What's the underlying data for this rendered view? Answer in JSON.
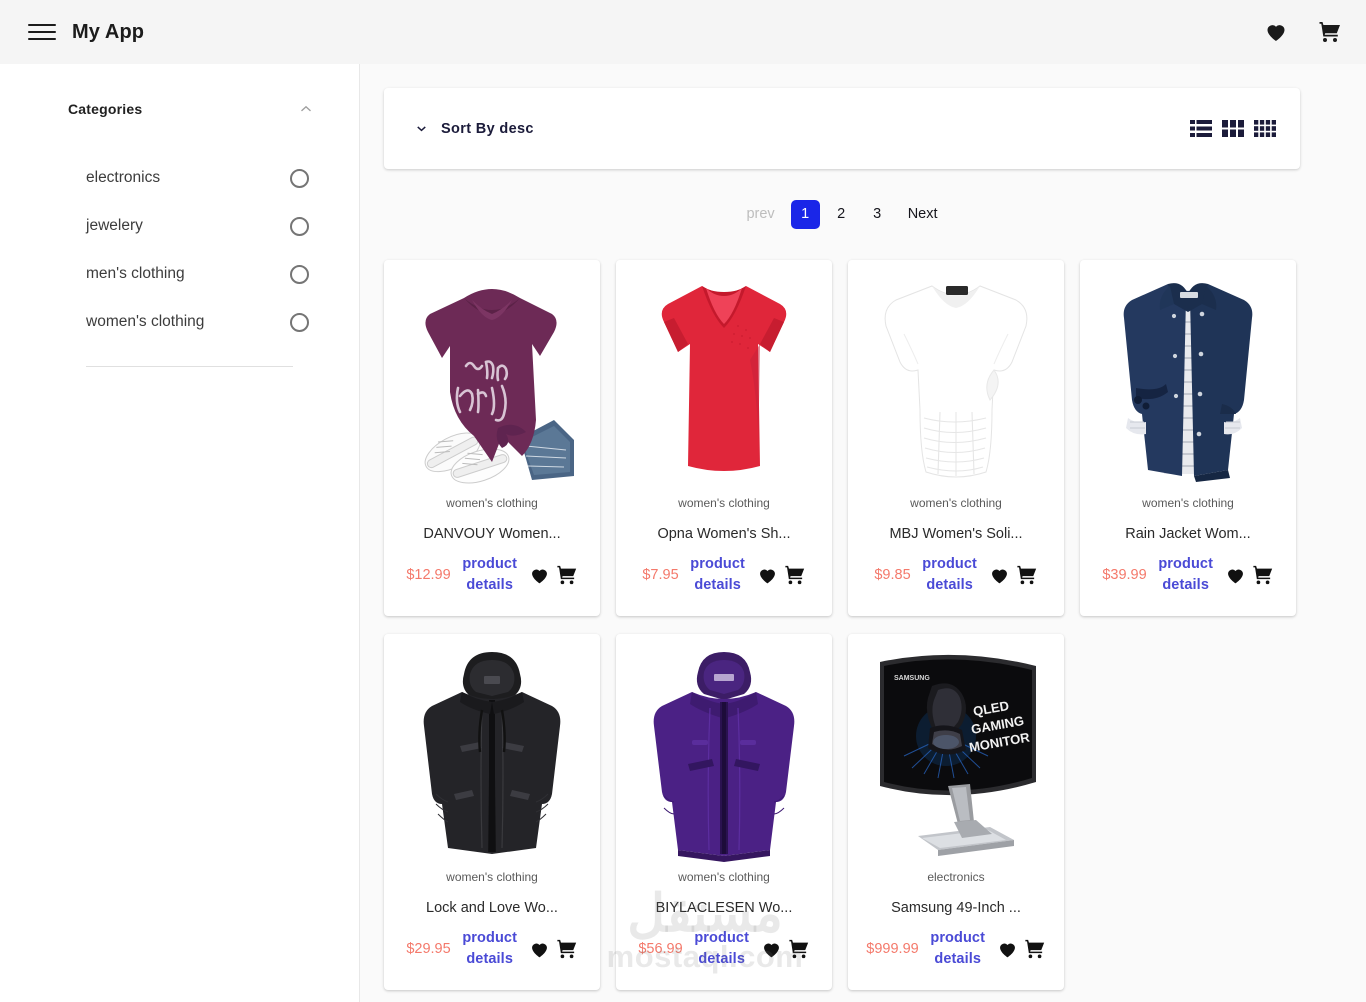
{
  "appbar": {
    "title": "My App",
    "menu_icon": "hamburger-menu-icon",
    "favorites_icon": "heart-icon",
    "cart_icon": "shopping-cart-icon"
  },
  "sidebar": {
    "header": "Categories",
    "collapse_icon": "chevron-up-icon",
    "categories": [
      {
        "label": "electronics",
        "selected": false
      },
      {
        "label": "jewelery",
        "selected": false
      },
      {
        "label": "men's clothing",
        "selected": false
      },
      {
        "label": "women's clothing",
        "selected": false
      }
    ]
  },
  "toolbar": {
    "sort_icon": "chevron-down-icon",
    "sort_label": "Sort By desc",
    "views": [
      {
        "name": "list-view",
        "label": "list"
      },
      {
        "name": "grid-3-view",
        "label": "grid 3"
      },
      {
        "name": "grid-4-view",
        "label": "grid 4"
      }
    ]
  },
  "pagination": {
    "prev_label": "prev",
    "pages": [
      "1",
      "2",
      "3"
    ],
    "active_page": "1",
    "next_label": "Next"
  },
  "products": [
    {
      "category": "women's clothing",
      "title": "DANVOUY Women...",
      "price": "$12.99",
      "details_label": "product details",
      "image": "purple-be-kind-tshirt",
      "favorite_icon": "heart-icon",
      "cart_icon": "shopping-cart-icon"
    },
    {
      "category": "women's clothing",
      "title": "Opna Women's Sh...",
      "price": "$7.95",
      "details_label": "product details",
      "image": "red-vneck-shirt",
      "favorite_icon": "heart-icon",
      "cart_icon": "shopping-cart-icon"
    },
    {
      "category": "women's clothing",
      "title": "MBJ Women's Soli...",
      "price": "$9.85",
      "details_label": "product details",
      "image": "white-draped-top",
      "favorite_icon": "heart-icon",
      "cart_icon": "shopping-cart-icon"
    },
    {
      "category": "women's clothing",
      "title": "Rain Jacket Wom...",
      "price": "$39.99",
      "details_label": "product details",
      "image": "navy-rain-jacket",
      "favorite_icon": "heart-icon",
      "cart_icon": "shopping-cart-icon"
    },
    {
      "category": "women's clothing",
      "title": "Lock and Love Wo...",
      "price": "$29.95",
      "details_label": "product details",
      "image": "black-hooded-jacket",
      "favorite_icon": "heart-icon",
      "cart_icon": "shopping-cart-icon"
    },
    {
      "category": "women's clothing",
      "title": "BIYLACLESEN Wo...",
      "price": "$56.99",
      "details_label": "product details",
      "image": "purple-winter-jacket",
      "favorite_icon": "heart-icon",
      "cart_icon": "shopping-cart-icon"
    },
    {
      "category": "electronics",
      "title": "Samsung 49-Inch ...",
      "price": "$999.99",
      "details_label": "product details",
      "image": "samsung-curved-monitor",
      "screen_text": "QLED GAMING MONITOR",
      "brand_text": "SAMSUNG",
      "favorite_icon": "heart-icon",
      "cart_icon": "shopping-cart-icon"
    }
  ],
  "watermark": {
    "arabic": "مستقل",
    "latin": "mostaql.com"
  },
  "colors": {
    "accent_blue": "#1a26e8",
    "price_red": "#f4796b",
    "link_indigo": "#4a4ad6",
    "appbar_bg": "#f5f5f5",
    "page_bg": "#fafafa"
  }
}
